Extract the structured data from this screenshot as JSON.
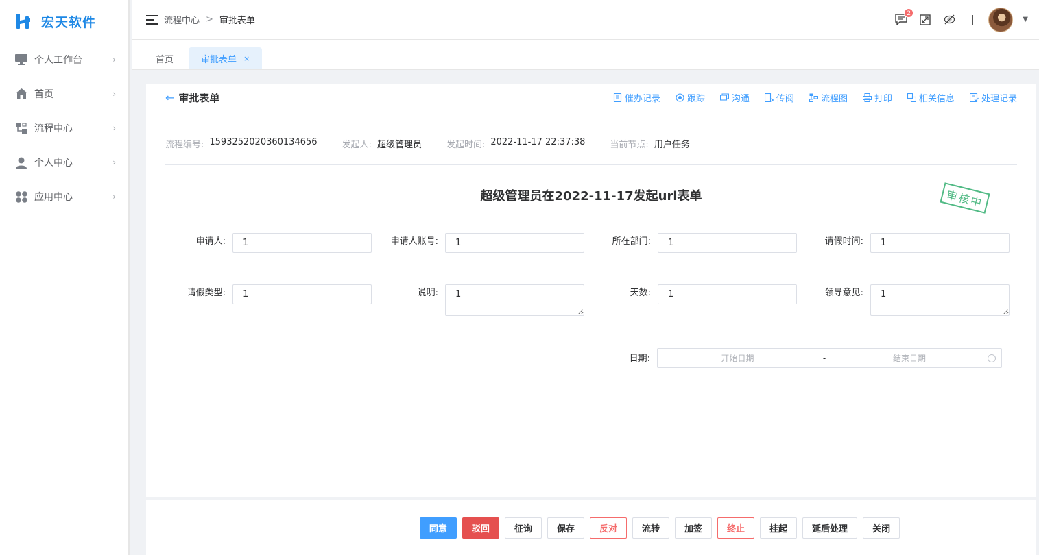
{
  "brand": {
    "name": "宏天软件",
    "color": "#1e88e5"
  },
  "sidebar": {
    "items": [
      {
        "label": "个人工作台",
        "icon": "monitor-icon"
      },
      {
        "label": "首页",
        "icon": "home-icon"
      },
      {
        "label": "流程中心",
        "icon": "flow-icon"
      },
      {
        "label": "个人中心",
        "icon": "user-icon"
      },
      {
        "label": "应用中心",
        "icon": "apps-icon"
      }
    ]
  },
  "header": {
    "breadcrumb": [
      "流程中心",
      "审批表单"
    ],
    "separator": ">",
    "message_count": "2"
  },
  "tabs": [
    {
      "label": "首页",
      "active": false
    },
    {
      "label": "审批表单",
      "active": true,
      "close": "×"
    }
  ],
  "card": {
    "back": "←",
    "title": "审批表单",
    "actions": [
      "催办记录",
      "跟踪",
      "沟通",
      "传阅",
      "流程图",
      "打印",
      "相关信息",
      "处理记录"
    ]
  },
  "info": {
    "process_no_label": "流程编号:",
    "process_no": "1593252020360134656",
    "initiator_label": "发起人:",
    "initiator": "超级管理员",
    "start_time_label": "发起时间:",
    "start_time": "2022-11-17 22:37:38",
    "node_label": "当前节点:",
    "node": "用户任务"
  },
  "form": {
    "title": "超级管理员在2022-11-17发起url表单",
    "stamp": "审核中",
    "fields": {
      "applicant": {
        "label": "申请人:",
        "value": "1"
      },
      "account": {
        "label": "申请人账号:",
        "value": "1"
      },
      "department": {
        "label": "所在部门:",
        "value": "1"
      },
      "leave_time": {
        "label": "请假时间:",
        "value": "1"
      },
      "leave_type": {
        "label": "请假类型:",
        "value": "1"
      },
      "description": {
        "label": "说明:",
        "value": "1"
      },
      "days": {
        "label": "天数:",
        "value": "1"
      },
      "leader_opinion": {
        "label": "领导意见:",
        "value": "1"
      }
    },
    "date": {
      "label": "日期:",
      "start_placeholder": "开始日期",
      "separator": "-",
      "end_placeholder": "结束日期"
    }
  },
  "footer": {
    "buttons": [
      "同意",
      "驳回",
      "征询",
      "保存",
      "反对",
      "流转",
      "加签",
      "终止",
      "挂起",
      "延后处理",
      "关闭"
    ]
  },
  "colors": {
    "primary": "#409eff",
    "danger": "#e5504f",
    "stamp": "#3fb378"
  }
}
